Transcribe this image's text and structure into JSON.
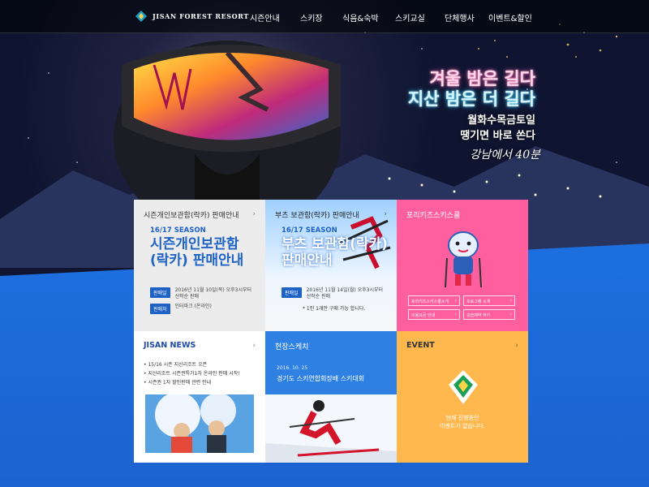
{
  "nav": {
    "logo_text": "JISAN FOREST RESORT",
    "items": [
      "시즌안내",
      "스키장",
      "식음&숙박",
      "스키교실",
      "단체행사",
      "이벤트&할인"
    ]
  },
  "hero": {
    "line1": "겨울 밤은 길다",
    "line2": "지산 밤은 더 길다",
    "line3": "월화수목금토일",
    "line4": "땡기면 바로 쏜다",
    "line5": "강남에서 40분"
  },
  "tiles": {
    "season_locker": {
      "title": "시즌개인보관함(락카) 판매안내",
      "season": "16/17 SEASON",
      "big_line1": "시즌개인보관함",
      "big_line2": "(락카) 판매안내",
      "rows": [
        {
          "label": "판매일",
          "value_line1": "2016년 11월 10일(목) 오후3시부터",
          "value_line2": "선착순 판매"
        },
        {
          "label": "판매처",
          "value_line1": "인터파크 (온라인)",
          "value_line2": ""
        }
      ]
    },
    "boots_locker": {
      "title": "부츠 보관함(락카) 판매안내",
      "season": "16/17 SEASON",
      "big_line1": "부츠 보관함(락카)",
      "big_line2": "판매안내",
      "rows": [
        {
          "label": "판매일",
          "value_line1": "2016년 11월 14일(월) 오후3시부터",
          "value_line2": "선착순 판매"
        }
      ],
      "note": "* 1인 1개만 구매 가능 합니다."
    },
    "kids": {
      "title": "포리키즈스키스쿨",
      "buttons": [
        "포리키즈스키스쿨소개",
        "프로그램 소개",
        "이용요금 안내",
        "강습예약 하기"
      ]
    },
    "news": {
      "title": "JISAN NEWS",
      "items": [
        "15/16 시즌 지산리조트 오픈",
        "지산리조트 시즌권특가1차 온라인 판매 시작!",
        "시즌권 1차 할인판매 관련 안내"
      ]
    },
    "sketch": {
      "title": "현장스케치",
      "date": "2016. 10. 25",
      "caption": "경기도 스키연합회장배 스키대회"
    },
    "event": {
      "title": "EVENT",
      "msg_line1": "현재 진행중인",
      "msg_line2": "이벤트가 없습니다."
    }
  },
  "colors": {
    "accent_blue": "#1f62c6",
    "pink": "#ff5f9f",
    "orange": "#ffb84d",
    "blue_tile": "#2f80e3"
  },
  "icons": {
    "arrow": "chevron-right-icon",
    "logo": "resort-logo-icon",
    "event_logo": "resort-leaf-icon"
  }
}
